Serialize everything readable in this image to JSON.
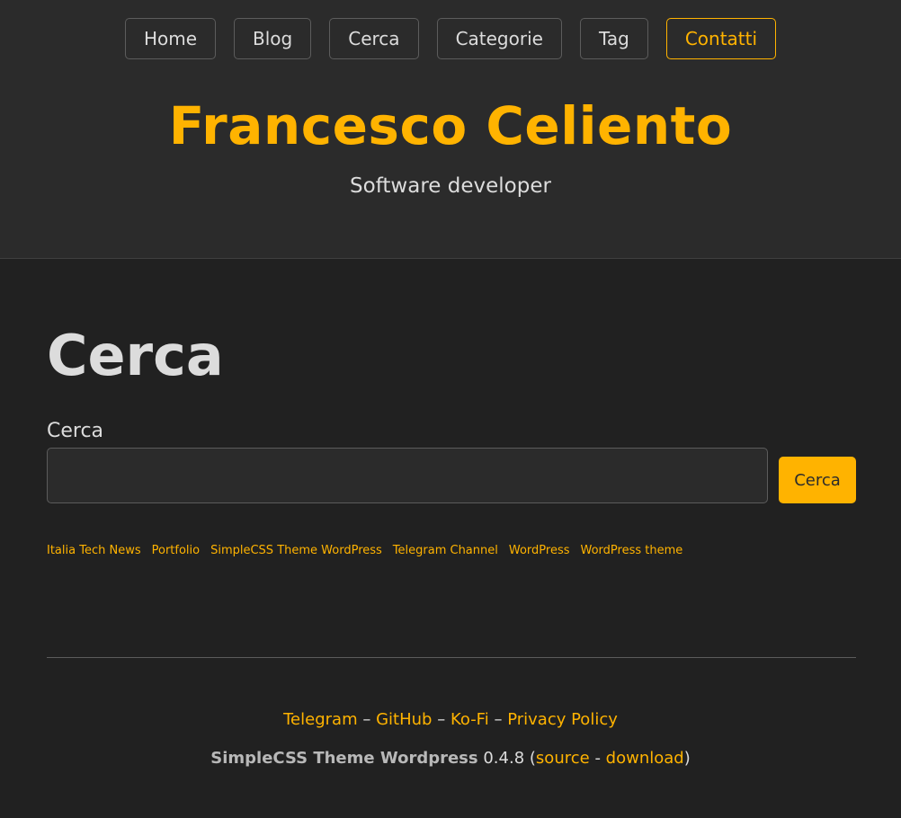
{
  "nav": {
    "items": [
      {
        "label": "Home"
      },
      {
        "label": "Blog"
      },
      {
        "label": "Cerca"
      },
      {
        "label": "Categorie"
      },
      {
        "label": "Tag"
      },
      {
        "label": "Contatti"
      }
    ],
    "active_index": 5
  },
  "site": {
    "title": "Francesco Celiento",
    "description": "Software developer"
  },
  "page": {
    "heading": "Cerca",
    "search_label": "Cerca",
    "search_value": "",
    "search_button": "Cerca"
  },
  "tags": [
    "Italia Tech News",
    "Portfolio",
    "SimpleCSS Theme WordPress",
    "Telegram Channel",
    "WordPress",
    "WordPress theme"
  ],
  "footer": {
    "links": [
      "Telegram",
      "GitHub",
      "Ko-Fi",
      "Privacy Policy"
    ],
    "separator": "–",
    "theme_name": "SimpleCSS Theme Wordpress",
    "version": "0.4.8",
    "source_label": "source",
    "download_label": "download"
  },
  "colors": {
    "accent": "#ffb300",
    "background": "#212121",
    "header_bg": "#2b2b2b",
    "text": "#dcdcdc"
  }
}
